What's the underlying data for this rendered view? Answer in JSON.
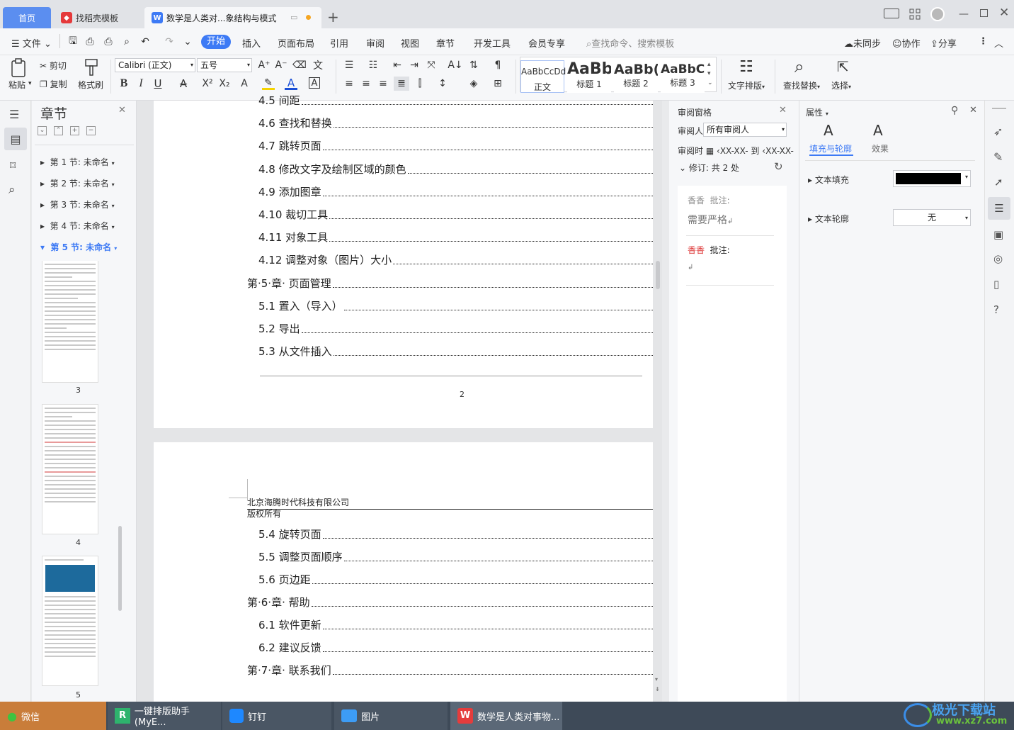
{
  "tabs": {
    "home": "首页",
    "template": "找稻壳模板",
    "document": "数学是人类对...象结构与模式"
  },
  "menu": {
    "file": "文件",
    "start": "开始",
    "insert": "插入",
    "layout": "页面布局",
    "reference": "引用",
    "review": "审阅",
    "view": "视图",
    "section": "章节",
    "devtools": "开发工具",
    "member": "会员专享",
    "search_placeholder": "查找命令、搜索模板",
    "unsynced": "未同步",
    "collab": "协作",
    "share": "分享"
  },
  "ribbon": {
    "paste": "粘贴",
    "cut": "剪切",
    "copy": "复制",
    "format_painter": "格式刷",
    "font": "Calibri (正文)",
    "size": "五号",
    "styles": [
      {
        "preview": "AaBbCcDd",
        "name": "正文"
      },
      {
        "preview": "AaBb",
        "name": "标题 1"
      },
      {
        "preview": "AaBb(",
        "name": "标题 2"
      },
      {
        "preview": "AaBbC(",
        "name": "标题 3"
      }
    ],
    "text_layout": "文字排版",
    "find_replace": "查找替换",
    "select": "选择"
  },
  "chapters": {
    "title": "章节",
    "sections": [
      {
        "label": "第 1 节: 未命名",
        "active": false
      },
      {
        "label": "第 2 节: 未命名",
        "active": false
      },
      {
        "label": "第 3 节: 未命名",
        "active": false
      },
      {
        "label": "第 4 节: 未命名",
        "active": false
      },
      {
        "label": "第 5 节: 未命名",
        "active": true
      }
    ],
    "thumb_numbers": [
      "3",
      "4",
      "5"
    ]
  },
  "document": {
    "page1_toc": [
      {
        "text": "4.5 间距",
        "level": 2
      },
      {
        "text": "4.6 查找和替换",
        "level": 2
      },
      {
        "text": "4.7 跳转页面",
        "level": 2
      },
      {
        "text": "4.8 修改文字及绘制区域的颜色",
        "level": 2
      },
      {
        "text": "4.9 添加图章",
        "level": 2
      },
      {
        "text": "4.10 裁切工具",
        "level": 2
      },
      {
        "text": "4.11 对象工具",
        "level": 2
      },
      {
        "text": "4.12 调整对象（图片）大小",
        "level": 2
      },
      {
        "text": "第·5·章· 页面管理",
        "level": 1
      },
      {
        "text": "5.1 置入（导入）",
        "level": 2
      },
      {
        "text": "5.2 导出",
        "level": 2
      },
      {
        "text": "5.3 从文件插入",
        "level": 2
      }
    ],
    "page_number": "2",
    "header_company": "北京海腾时代科技有限公司",
    "header_rights": "版权所有",
    "page2_toc": [
      {
        "text": "5.4 旋转页面",
        "level": 2
      },
      {
        "text": "5.5 调整页面顺序",
        "level": 2
      },
      {
        "text": "5.6 页边距",
        "level": 2
      },
      {
        "text": "第·6·章· 帮助",
        "level": 1
      },
      {
        "text": "6.1 软件更新",
        "level": 2
      },
      {
        "text": "6.2 建议反馈",
        "level": 2
      },
      {
        "text": "第·7·章· 联系我们",
        "level": 1
      }
    ]
  },
  "review": {
    "title": "审阅窗格",
    "reviewer_label": "审阅人",
    "reviewer_value": "所有审阅人",
    "time_label": "审阅时",
    "time_from": "XX-XX-",
    "time_to_word": "到",
    "time_to": "XX-XX-",
    "revisions_label": "修订:",
    "revisions_count": "共 2 处",
    "comments": [
      {
        "author": "香香",
        "type": "批注:",
        "text": "需要严格"
      },
      {
        "author": "香香",
        "type": "批注:",
        "text": ""
      }
    ]
  },
  "props": {
    "title": "属性",
    "tab_fill": "填充与轮廓",
    "tab_effect": "效果",
    "text_fill": "文本填充",
    "text_outline": "文本轮廓",
    "outline_value": "无",
    "fill_color": "#000000",
    "accent": "#3d7af5"
  },
  "taskbar": {
    "wechat": "微信",
    "myeditor": "一键排版助手(MyE...",
    "dingtalk": "钉钉",
    "pictures": "图片",
    "wps": "数学是人类对事物...",
    "watermark": "极光下载站",
    "watermark_url": "www.xz7.com"
  }
}
